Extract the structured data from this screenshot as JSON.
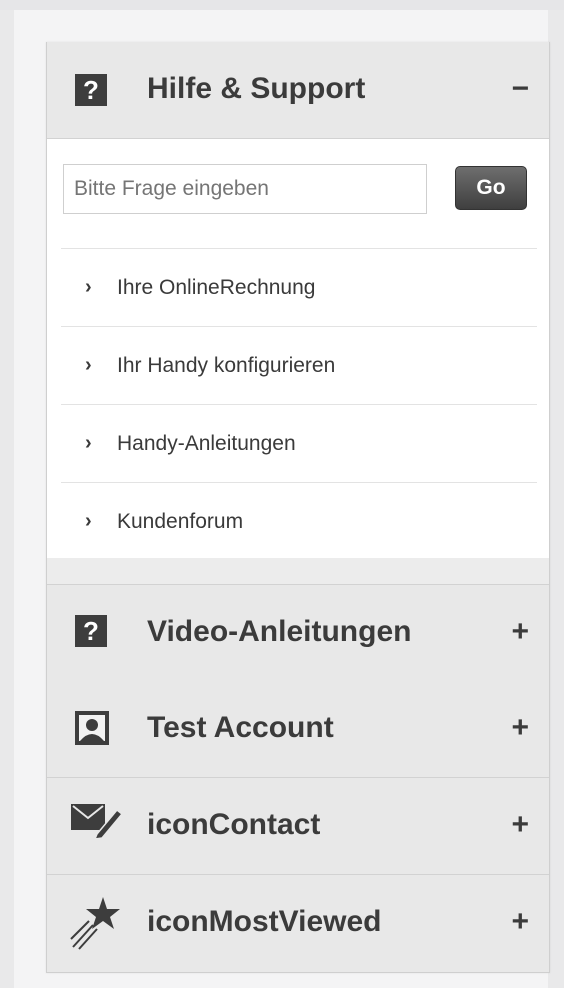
{
  "help_section": {
    "title": "Hilfe & Support",
    "toggle": "−",
    "icon": "question-icon",
    "icon_glyph": "?",
    "search": {
      "placeholder": "Bitte Frage eingeben",
      "button_label": "Go"
    },
    "links": [
      {
        "chevron": "›",
        "label": "Ihre OnlineRechnung"
      },
      {
        "chevron": "›",
        "label": "Ihr Handy konfigurieren"
      },
      {
        "chevron": "›",
        "label": "Handy-Anleitungen"
      },
      {
        "chevron": "›",
        "label": "Kundenforum"
      }
    ]
  },
  "collapsed_sections": [
    {
      "title": "Video-Anleitungen",
      "toggle": "+",
      "icon": "question-icon",
      "icon_glyph": "?"
    },
    {
      "title": "Test Account",
      "toggle": "+",
      "icon": "user-icon"
    },
    {
      "title": "iconContact",
      "toggle": "+",
      "icon": "envelope-pen-icon"
    },
    {
      "title": "iconMostViewed",
      "toggle": "+",
      "icon": "shooting-star-icon"
    }
  ],
  "colors": {
    "header_bg": "#e8e8e8",
    "text_dark": "#3b3b3b",
    "button_dark": "#4a4a4a"
  }
}
